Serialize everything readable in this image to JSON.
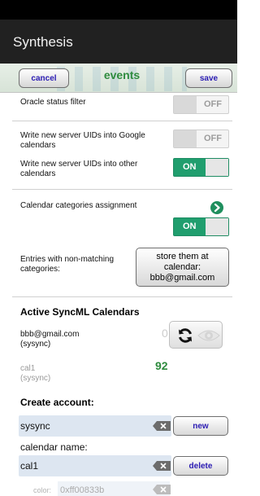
{
  "app": {
    "title": "Synthesis"
  },
  "toolbar": {
    "cancel_label": "cancel",
    "center_label": "events",
    "save_label": "save"
  },
  "settings": {
    "oracle_status_filter": {
      "label": "Oracle status filter",
      "toggle": "OFF"
    },
    "write_uids_google": {
      "label": "Write new server UIDs into Google calendars",
      "toggle": "OFF"
    },
    "write_uids_other": {
      "label": "Write new server UIDs into other calendars",
      "toggle": "ON"
    },
    "calendar_categories": {
      "label": "Calendar categories assignment",
      "toggle": "ON"
    },
    "non_matching": {
      "label": "Entries with non-matching categories:",
      "button_lines": [
        "store them at",
        "calendar:",
        "bbb@gmail.com"
      ]
    }
  },
  "active_calendars": {
    "heading": "Active SyncML Calendars",
    "items": [
      {
        "name": "bbb@gmail.com",
        "account": "(sysync)",
        "count": "0"
      },
      {
        "name": "cal1",
        "account": "(sysync)",
        "count": "92"
      }
    ]
  },
  "create_account": {
    "heading": "Create account:",
    "account_value": "sysync",
    "new_label": "new",
    "calendar_name_label": "calendar name:",
    "calendar_value": "cal1",
    "delete_label": "delete",
    "color_label": "color:",
    "color_value": "0xff00833b"
  },
  "colors": {
    "accent_green": "#209e6e",
    "button_text": "#2a1bb3",
    "appbar": "#212121",
    "field_bg": "#dde6f1"
  },
  "icons": [
    "sync-icon",
    "eye-icon",
    "chevron-right-icon",
    "clear-icon"
  ]
}
